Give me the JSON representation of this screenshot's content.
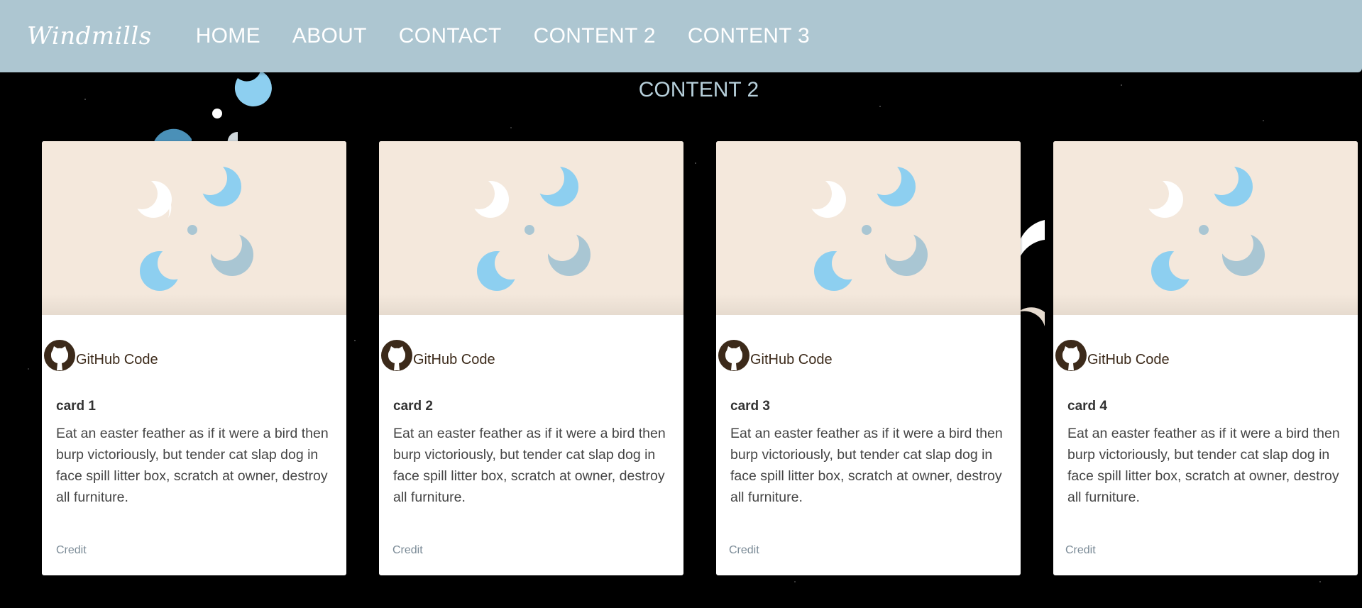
{
  "nav": {
    "brand": "Windmills",
    "links": [
      "HOME",
      "ABOUT",
      "CONTACT",
      "CONTENT 2",
      "CONTENT 3"
    ]
  },
  "section": {
    "title": "CONTENT 2"
  },
  "cards": [
    {
      "title": "card 1",
      "github_label": "GitHub Code",
      "text": "Eat an easter feather as if it were a bird then burp victoriously, but tender cat slap dog in face spill litter box, scratch at owner, destroy all furniture.",
      "footer": "Credit"
    },
    {
      "title": "card 2",
      "github_label": "GitHub Code",
      "text": "Eat an easter feather as if it were a bird then burp victoriously, but tender cat slap dog in face spill litter box, scratch at owner, destroy all furniture.",
      "footer": "Credit"
    },
    {
      "title": "card 3",
      "github_label": "GitHub Code",
      "text": "Eat an easter feather as if it were a bird then burp victoriously, but tender cat slap dog in face spill litter box, scratch at owner, destroy all furniture.",
      "footer": "Credit"
    },
    {
      "title": "card 4",
      "github_label": "GitHub Code",
      "text": "Eat an easter feather as if it were a bird then burp victoriously, but tender cat slap dog in face spill litter box, scratch at owner, destroy all furniture.",
      "footer": "Credit"
    }
  ],
  "colors": {
    "nav_bg": "#adc6d1",
    "card_image_bg": "#f4e8dc",
    "crescent_light_blue": "#8dcff0",
    "crescent_grey_blue": "#a9c6d3",
    "github_icon": "#3c2a1a"
  },
  "icons": {
    "github": "github-octocat-icon",
    "card_art": "crescent-moon-pinwheel-icon"
  }
}
